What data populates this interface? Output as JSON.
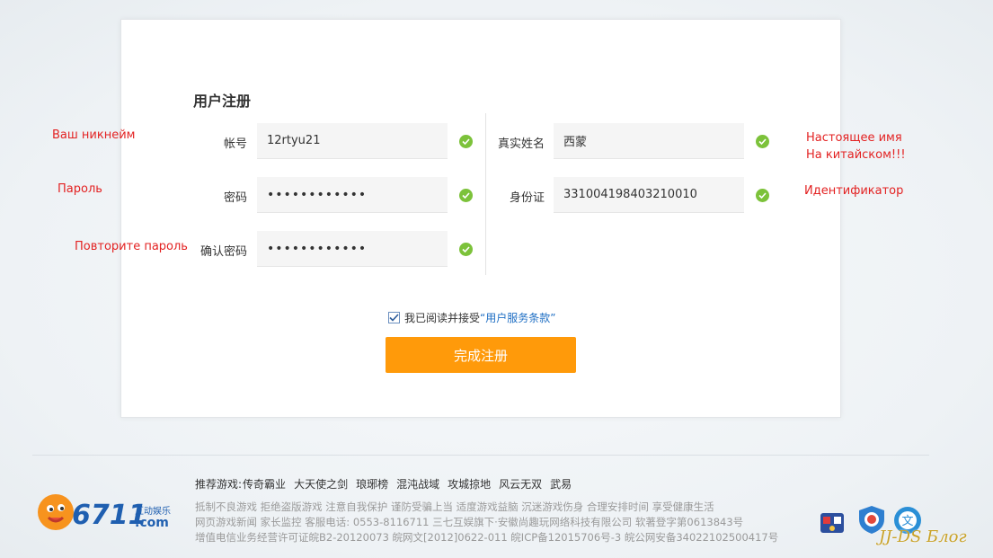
{
  "form": {
    "title": "用户注册",
    "account_label": "帐号",
    "account_value": "12rtyu21",
    "password_label": "密码",
    "password_value": "••••••••••••",
    "confirm_label": "确认密码",
    "confirm_value": "••••••••••••",
    "realname_label": "真实姓名",
    "realname_value": "西蒙",
    "idcard_label": "身份证",
    "idcard_value": "331004198403210010",
    "agree_text": "我已阅读并接受",
    "terms_link": "“用户服务条款”",
    "agree_checked": true,
    "submit_label": "完成注册"
  },
  "annotations": {
    "nickname": "Ваш никнейм",
    "password": "Пароль",
    "repeat_password": "Повторите пароль",
    "real_name_1": "Настоящее имя",
    "real_name_2": "На китайском!!!",
    "id": "Идентификатор"
  },
  "footer": {
    "recommend_label": "推荐游戏:",
    "games": [
      "传奇霸业",
      "大天使之剑",
      "琅琊榜",
      "混沌战域",
      "攻城掠地",
      "风云无双",
      "武易"
    ],
    "line1": "抵制不良游戏  拒绝盗版游戏  注意自我保护  谨防受骗上当  适度游戏益脑  沉迷游戏伤身  合理安排时间  享受健康生活",
    "line2": "网页游戏新闻  家长监控  客服电话: 0553-8116711   三七互娱旗下·安徽尚趣玩网络科技有限公司   软著登字第0613843号",
    "line3": "增值电信业务经营许可证皖B2-20120073   皖网文[2012]0622-011   皖ICP备12015706号-3   皖公网安备34022102500417号",
    "logo_number": "6711",
    "logo_small": "互动娱乐",
    "logo_domain": ".com"
  },
  "watermark": "JJ-DS Блог",
  "colors": {
    "accent": "#ff9a0a",
    "check": "#7cc23a",
    "annotation": "#e32222",
    "link": "#1f6fc4"
  }
}
